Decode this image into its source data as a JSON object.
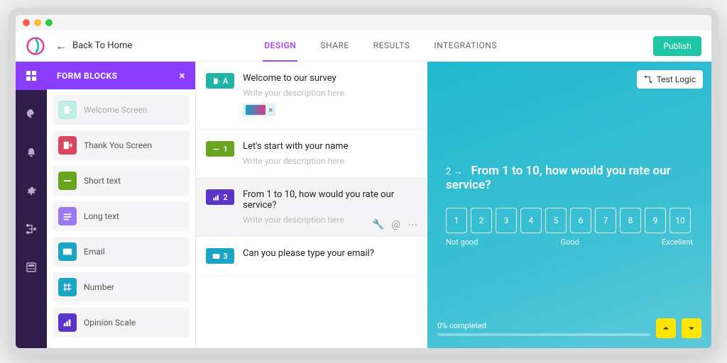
{
  "topbar": {
    "back_label": "Back To Home",
    "tabs": [
      "DESIGN",
      "SHARE",
      "RESULTS",
      "INTEGRATIONS"
    ],
    "active_tab": 0,
    "publish_label": "Publish"
  },
  "blocks_panel": {
    "title": "FORM BLOCKS",
    "items": [
      {
        "label": "Welcome Screen",
        "color": "#bfeee8",
        "muted": true,
        "icon": "door"
      },
      {
        "label": "Thank You Screen",
        "color": "#d7475f",
        "icon": "door-out"
      },
      {
        "label": "Short text",
        "color": "#6aa522",
        "icon": "dash"
      },
      {
        "label": "Long text",
        "color": "#9a7af0",
        "icon": "lines"
      },
      {
        "label": "Email",
        "color": "#1aa5c4",
        "icon": "mail"
      },
      {
        "label": "Number",
        "color": "#1aa5c4",
        "icon": "hash"
      },
      {
        "label": "Opinion Scale",
        "color": "#5c34c9",
        "icon": "bars"
      }
    ]
  },
  "questions": [
    {
      "tag": "A",
      "tag_color": "#1fb4a6",
      "title": "Welcome to our survey",
      "desc_placeholder": "Write your description here",
      "icon": "door",
      "has_chip": true
    },
    {
      "tag": "1",
      "tag_color": "#6aa522",
      "title": "Let's start with your name",
      "desc_placeholder": "Write your description here",
      "icon": "dash"
    },
    {
      "tag": "2",
      "tag_color": "#5c34c9",
      "title": "From 1 to 10, how would you rate our service?",
      "desc_placeholder": "Write your description here",
      "icon": "bars",
      "selected": true,
      "show_tools": true
    },
    {
      "tag": "3",
      "tag_color": "#1aa5c4",
      "title": "Can you please type your email?",
      "desc_placeholder": "",
      "icon": "mail"
    }
  ],
  "preview": {
    "test_logic_label": "Test Logic",
    "question_number": "2",
    "question_title": "From 1 to 10, how would you rate our service?",
    "scale_values": [
      "1",
      "2",
      "3",
      "4",
      "5",
      "6",
      "7",
      "8",
      "9",
      "10"
    ],
    "label_low": "Not good",
    "label_mid": "Good",
    "label_high": "Excellent",
    "progress_text": "0% completed"
  }
}
